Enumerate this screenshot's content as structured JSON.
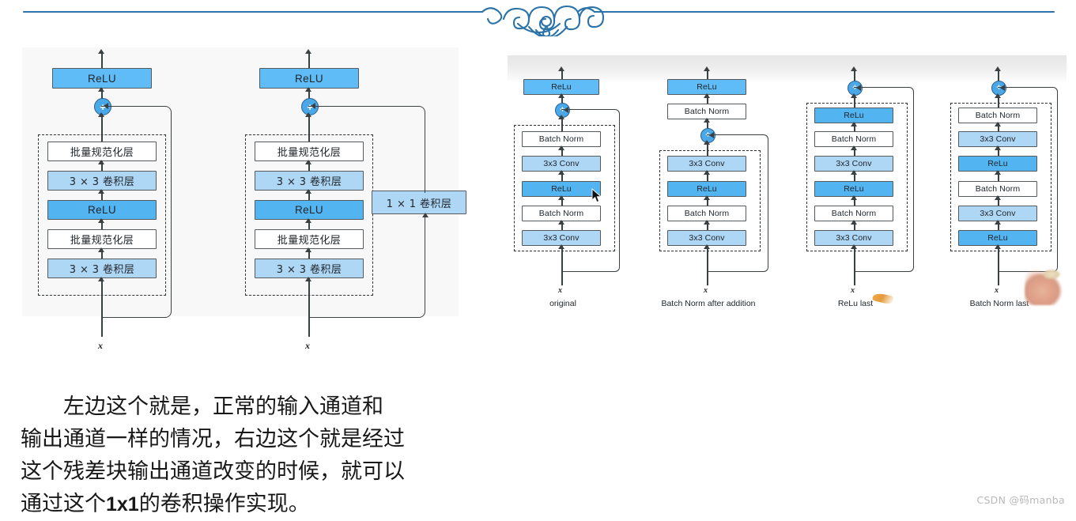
{
  "divider": {
    "icon": "ornamental-flourish-divider",
    "color": "#2a72a8"
  },
  "left_figure": {
    "label": "residual-block-comparison-cn",
    "blocks": [
      {
        "name": "identity-residual-block",
        "input_label": "x",
        "top_node": "ReLU",
        "plus": "+",
        "inner_nodes": [
          "批量规范化层",
          "3 × 3 卷积层",
          "ReLU",
          "批量规范化层",
          "3 × 3 卷积层"
        ],
        "side_node": null
      },
      {
        "name": "projection-residual-block",
        "input_label": "x",
        "top_node": "ReLU",
        "plus": "+",
        "inner_nodes": [
          "批量规范化层",
          "3 × 3 卷积层",
          "ReLU",
          "批量规范化层",
          "3 × 3 卷积层"
        ],
        "side_node": "1 × 1 卷积层"
      }
    ]
  },
  "right_figure": {
    "label": "resnet-variant-orderings",
    "columns": [
      {
        "caption": "original",
        "input_label": "x",
        "outside_nodes": [
          "ReLu"
        ],
        "plus": "+",
        "inner_nodes": [
          "Batch Norm",
          "3x3 Conv",
          "ReLu",
          "Batch Norm",
          "3x3 Conv"
        ]
      },
      {
        "caption": "Batch Norm after addition",
        "input_label": "x",
        "outside_nodes": [
          "ReLu",
          "Batch Norm"
        ],
        "plus": "+",
        "inner_nodes": [
          "3x3 Conv",
          "ReLu",
          "Batch Norm",
          "3x3 Conv"
        ]
      },
      {
        "caption": "ReLu last",
        "input_label": "x",
        "outside_nodes": [],
        "plus": "+",
        "inner_nodes": [
          "ReLu",
          "Batch Norm",
          "3x3 Conv",
          "ReLu",
          "Batch Norm",
          "3x3 Conv"
        ]
      },
      {
        "caption": "Batch Norm last",
        "input_label": "x",
        "outside_nodes": [],
        "plus": "+",
        "inner_nodes": [
          "Batch Norm",
          "3x3 Conv",
          "ReLu",
          "Batch Norm",
          "3x3 Conv",
          "ReLu"
        ]
      }
    ]
  },
  "narration": {
    "line1": "左边这个就是，正常的输入通道和",
    "line2": "输出通道一样的情况，右边这个就是经过",
    "line3": "这个残差块输出通道改变的时候，就可以",
    "line4_a": "通过这个",
    "line4_b": "1x1",
    "line4_c": "的卷积操作实现。"
  },
  "overlays": {
    "mouse_cursor": "mouse-pointer-arrow",
    "laser_pointer": "orange-laser-pointer-trace",
    "hand": "blurred-hand-overlay"
  },
  "watermark": "CSDN @码manba",
  "colors": {
    "relu_dark": "#53b4f2",
    "relu_light": "#5fbcf6",
    "conv": "#aed6f5",
    "batchnorm": "#ffffff",
    "plus": "#4aa8e8",
    "stroke": "#3b4043",
    "divider": "#2a72a8"
  }
}
